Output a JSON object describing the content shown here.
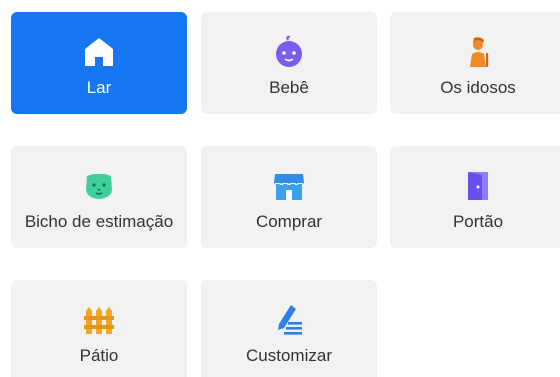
{
  "tiles": [
    {
      "label": "Lar",
      "icon": "house-icon",
      "selected": true
    },
    {
      "label": "Bebê",
      "icon": "baby-face-icon",
      "selected": false
    },
    {
      "label": "Os idosos",
      "icon": "elderly-person-icon",
      "selected": false
    },
    {
      "label": "Bicho de estimação",
      "icon": "pet-face-icon",
      "selected": false
    },
    {
      "label": "Comprar",
      "icon": "shop-icon",
      "selected": false
    },
    {
      "label": "Portão",
      "icon": "door-icon",
      "selected": false
    },
    {
      "label": "Pátio",
      "icon": "fence-icon",
      "selected": false
    },
    {
      "label": "Customizar",
      "icon": "pen-edit-icon",
      "selected": false
    }
  ],
  "colors": {
    "selected_bg": "#1677f2",
    "tile_bg": "#f2f2f2",
    "baby_icon": "#7b5cf0",
    "elderly_icon": "#f08a24",
    "pet_icon": "#3fcf9a",
    "shop_icon": "#2f8fe8",
    "door_icon": "#6a4ff0",
    "fence_icon": "#f5a623",
    "pen_icon": "#2f7fe8"
  }
}
